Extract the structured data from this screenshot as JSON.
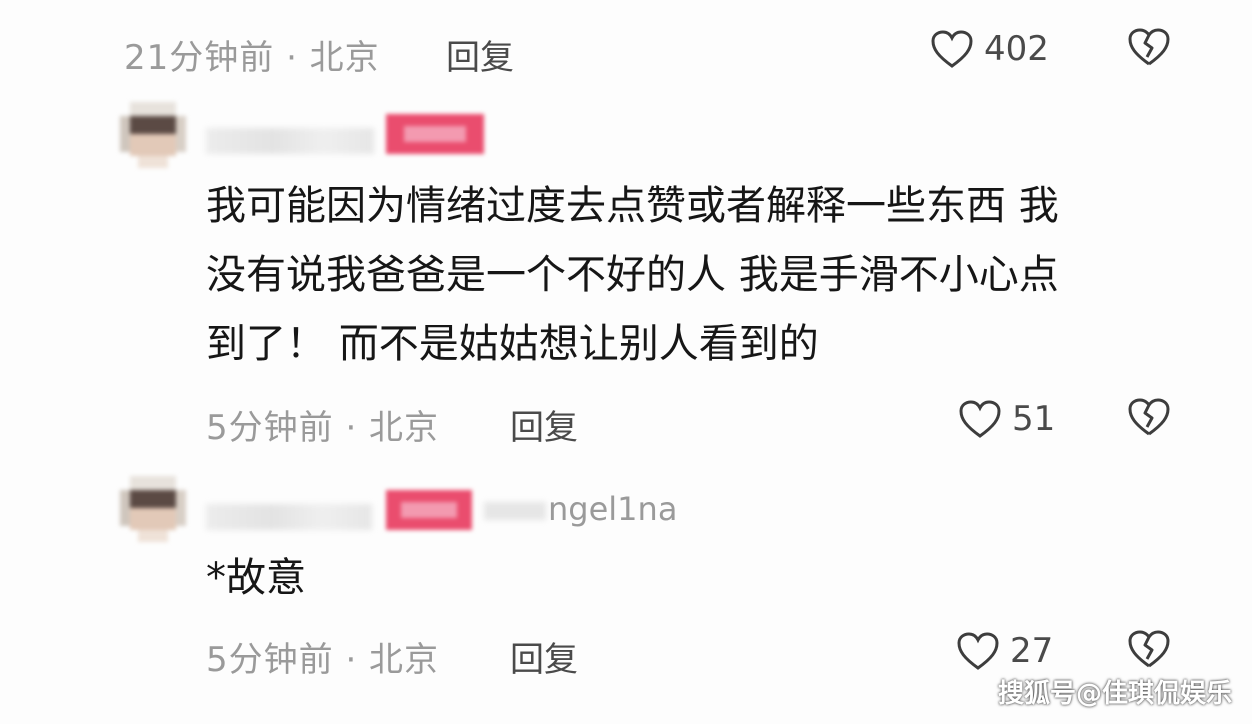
{
  "comments": [
    {
      "time_location": "21分钟前 · 北京",
      "reply_label": "回复",
      "like_count": "402"
    },
    {
      "text": "我可能因为情绪过度去点赞或者解释一些东西 我\n没有说我爸爸是一个不好的人 我是手滑不小心点\n到了！ 而不是姑姑想让别人看到的",
      "time_location": "5分钟前 · 北京",
      "reply_label": "回复",
      "like_count": "51"
    },
    {
      "reply_to_suffix": "ngel1na",
      "text": "*故意",
      "time_location": "5分钟前 · 北京",
      "reply_label": "回复",
      "like_count": "27"
    }
  ],
  "icons": {
    "like": "heart-outline-icon",
    "dislike": "broken-heart-icon"
  },
  "colors": {
    "badge": "#ea4d6e",
    "meta_text": "#9a9a9a",
    "body_text": "#161616"
  },
  "watermark": "搜狐号@佳琪侃娱乐"
}
